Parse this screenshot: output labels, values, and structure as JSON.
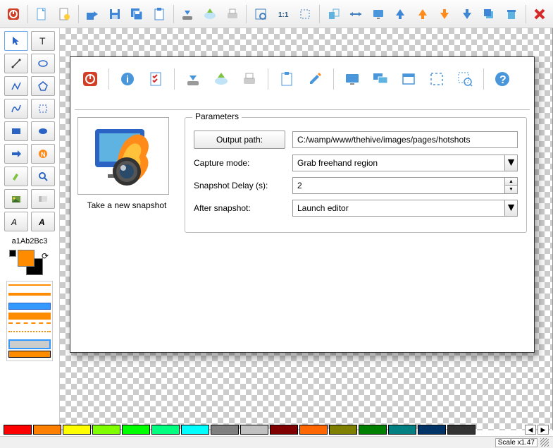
{
  "sample_text": "a1Ab2Bc3",
  "dialog": {
    "snapshot_caption": "Take a new snapshot",
    "params_legend": "Parameters",
    "output_path_label": "Output path:",
    "output_path_value": "C:/wamp/www/thehive/images/pages/hotshots",
    "capture_mode_label": "Capture mode:",
    "capture_mode_value": "Grab freehand region",
    "delay_label": "Snapshot Delay (s):",
    "delay_value": "2",
    "after_label": "After snapshot:",
    "after_value": "Launch editor"
  },
  "status": {
    "scale": "Scale x1.47"
  },
  "palette": [
    "#ff0000",
    "#ff8000",
    "#ffff00",
    "#80ff00",
    "#00ff00",
    "#00ff80",
    "#00ffff",
    "#808080",
    "#c0c0c0",
    "#800000",
    "#ff6600",
    "#808000",
    "#008000",
    "#008080",
    "#003366",
    "#333333"
  ]
}
